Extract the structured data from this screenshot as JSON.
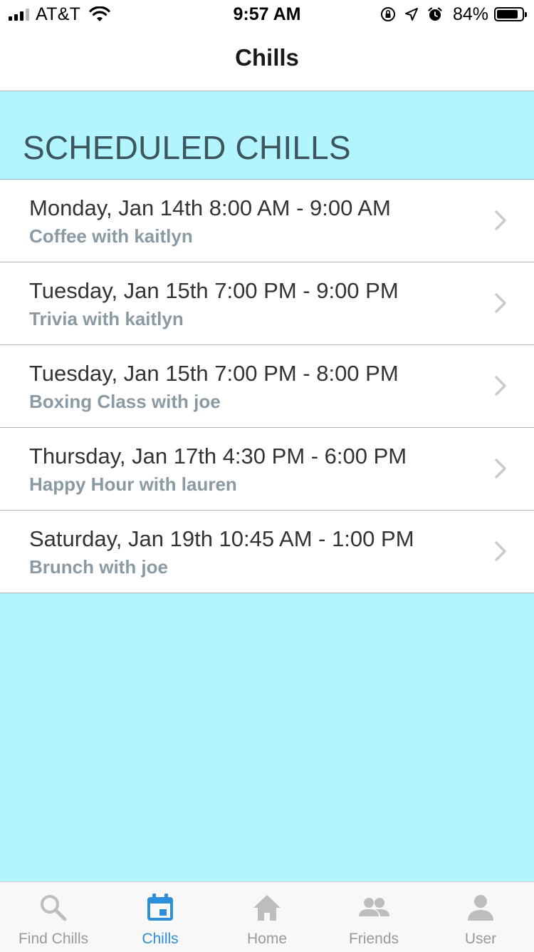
{
  "status_bar": {
    "carrier": "AT&T",
    "time": "9:57 AM",
    "battery_percent": "84%",
    "battery_level": 0.84,
    "icons": [
      "signal-icon",
      "wifi-icon",
      "orientation-lock-icon",
      "location-icon",
      "alarm-icon",
      "battery-icon"
    ]
  },
  "nav": {
    "title": "Chills"
  },
  "section": {
    "title": "SCHEDULED CHILLS"
  },
  "chills": [
    {
      "when": "Monday, Jan 14th 8:00 AM - 9:00 AM",
      "what": "Coffee with kaitlyn"
    },
    {
      "when": "Tuesday, Jan 15th 7:00 PM - 9:00 PM",
      "what": "Trivia with kaitlyn"
    },
    {
      "when": "Tuesday, Jan 15th 7:00 PM - 8:00 PM",
      "what": "Boxing Class with joe"
    },
    {
      "when": "Thursday, Jan 17th 4:30 PM - 6:00 PM",
      "what": "Happy Hour with lauren"
    },
    {
      "when": "Saturday, Jan 19th 10:45 AM - 1:00 PM",
      "what": "Brunch with joe"
    }
  ],
  "tabs": [
    {
      "label": "Find Chills",
      "icon": "search-icon",
      "active": false
    },
    {
      "label": "Chills",
      "icon": "calendar-icon",
      "active": true
    },
    {
      "label": "Home",
      "icon": "home-icon",
      "active": false
    },
    {
      "label": "Friends",
      "icon": "friends-icon",
      "active": false
    },
    {
      "label": "User",
      "icon": "user-icon",
      "active": false
    }
  ],
  "colors": {
    "background": "#b2f5ff",
    "active_tab": "#2d8fd9",
    "inactive_tab": "#9a9a9a",
    "subtitle": "#8a9aa4"
  }
}
